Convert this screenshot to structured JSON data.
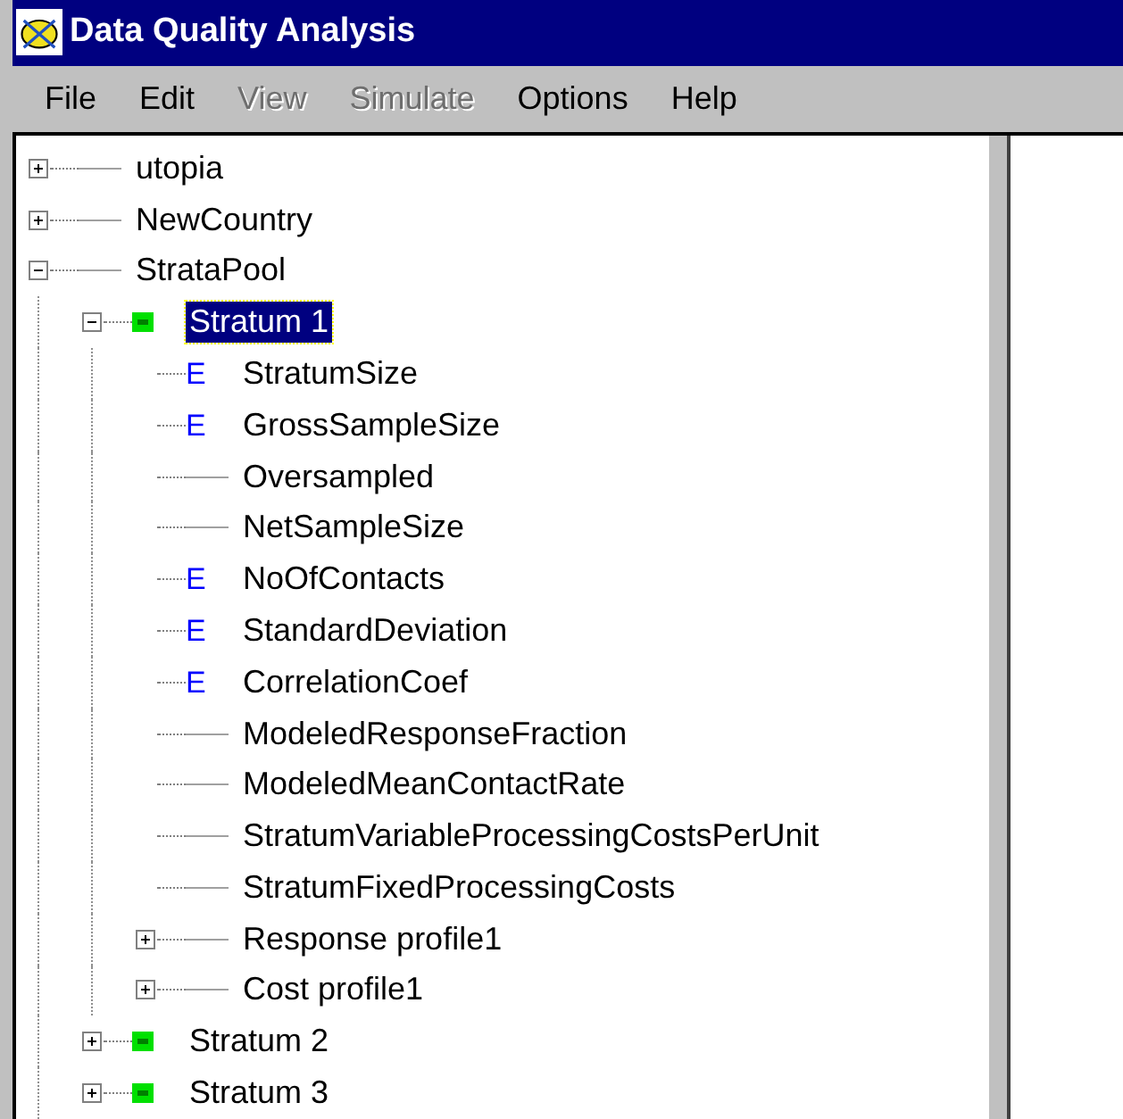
{
  "window": {
    "title": "Data Quality Analysis"
  },
  "menu": [
    {
      "label": "File",
      "disabled": false
    },
    {
      "label": "Edit",
      "disabled": false
    },
    {
      "label": "View",
      "disabled": true
    },
    {
      "label": "Simulate",
      "disabled": true
    },
    {
      "label": "Options",
      "disabled": false
    },
    {
      "label": "Help",
      "disabled": false
    }
  ],
  "tree": [
    {
      "label": "utopia",
      "kind": "folder",
      "expanded": false,
      "selected": false
    },
    {
      "label": "NewCountry",
      "kind": "folder",
      "expanded": false,
      "selected": false
    },
    {
      "label": "StrataPool",
      "kind": "folder",
      "expanded": true,
      "selected": false,
      "children": [
        {
          "label": "Stratum 1",
          "kind": "stratum",
          "expanded": true,
          "selected": true,
          "children": [
            {
              "label": "StratumSize",
              "kind": "variable",
              "badge": "E",
              "selected": false
            },
            {
              "label": "GrossSampleSize",
              "kind": "variable",
              "badge": "E",
              "selected": false
            },
            {
              "label": "Oversampled",
              "kind": "folder",
              "selected": false
            },
            {
              "label": "NetSampleSize",
              "kind": "folder",
              "selected": false
            },
            {
              "label": "NoOfContacts",
              "kind": "variable",
              "badge": "E",
              "selected": false
            },
            {
              "label": "StandardDeviation",
              "kind": "variable",
              "badge": "E",
              "selected": false
            },
            {
              "label": "CorrelationCoef",
              "kind": "variable",
              "badge": "E",
              "selected": false
            },
            {
              "label": "ModeledResponseFraction",
              "kind": "folder",
              "selected": false
            },
            {
              "label": "ModeledMeanContactRate",
              "kind": "folder",
              "selected": false
            },
            {
              "label": "StratumVariableProcessingCostsPerUnit",
              "kind": "folder",
              "selected": false
            },
            {
              "label": "StratumFixedProcessingCosts",
              "kind": "folder",
              "selected": false
            },
            {
              "label": "Response profile1",
              "kind": "folder",
              "expanded": false,
              "selected": false
            },
            {
              "label": "Cost profile1",
              "kind": "folder",
              "expanded": false,
              "selected": false
            }
          ]
        },
        {
          "label": "Stratum 2",
          "kind": "stratum",
          "expanded": false,
          "selected": false
        },
        {
          "label": "Stratum 3",
          "kind": "stratum",
          "expanded": false,
          "selected": false
        }
      ]
    }
  ]
}
